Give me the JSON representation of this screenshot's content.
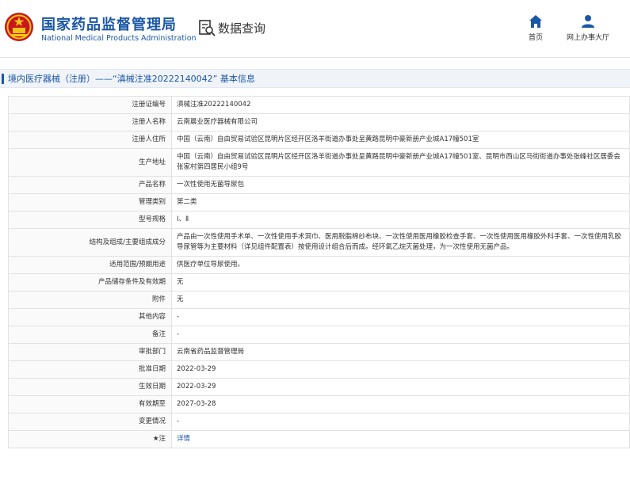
{
  "header": {
    "title_cn": "国家药品监督管理局",
    "title_en": "National Medical Products Administration",
    "search_label": "数据查询",
    "nav_home": "首页",
    "nav_office": "网上办事大厅"
  },
  "breadcrumb": {
    "text": "境内医疗器械（注册）——“滇械注准20222140042” 基本信息"
  },
  "rows": [
    {
      "label": "注册证编号",
      "value": "滇械注准20222140042"
    },
    {
      "label": "注册人名称",
      "value": "云南晨业医疗器械有限公司"
    },
    {
      "label": "注册人住所",
      "value": "中国（云南）自由贸易试验区昆明片区经开区洛羊街道办事处呈黄路昆明中豪新册产业城A17幢501室"
    },
    {
      "label": "生产地址",
      "value": "中国（云南）自由贸易试验区昆明片区经开区洛羊街道办事处呈黄路昆明中豪新册产业城A17幢501室、昆明市西山区马街街道办事处张峰社区居委会张家村第四居民小组9号"
    },
    {
      "label": "产品名称",
      "value": "一次性使用无菌导尿包"
    },
    {
      "label": "管理类别",
      "value": "第二类"
    },
    {
      "label": "型号规格",
      "value": "Ⅰ、Ⅱ"
    },
    {
      "label": "结构及组成/主要组成成分",
      "value": "产品由一次性使用手术单、一次性使用手术洞巾、医用脱脂棉纱布块、一次性使用医用橡胶检查手套、一次性使用医用橡胶外科手套、一次性使用乳胶导尿管等为主要材料（详见组件配置表）按使用设计组合后而成。经环氧乙烷灭菌处理，为一次性使用无菌产品。"
    },
    {
      "label": "适用范围/预期用途",
      "value": "供医疗单位导尿使用。"
    },
    {
      "label": "产品储存条件及有效期",
      "value": "无"
    },
    {
      "label": "附件",
      "value": "无"
    },
    {
      "label": "其他内容",
      "value": "-"
    },
    {
      "label": "备注",
      "value": "-"
    },
    {
      "label": "审批部门",
      "value": "云南省药品监督管理局"
    },
    {
      "label": "批准日期",
      "value": "2022-03-29"
    },
    {
      "label": "生效日期",
      "value": "2022-03-29"
    },
    {
      "label": "有效期至",
      "value": "2027-03-28"
    },
    {
      "label": "变更情况",
      "value": "-"
    },
    {
      "label": "注",
      "value": "详情"
    }
  ],
  "colors": {
    "brand": "#1a57a5",
    "logo_red": "#c8161d",
    "logo_gold": "#f2c318"
  },
  "icons": [
    "national-emblem-icon",
    "search-document-icon",
    "home-icon",
    "user-icon",
    "star-note-icon"
  ]
}
